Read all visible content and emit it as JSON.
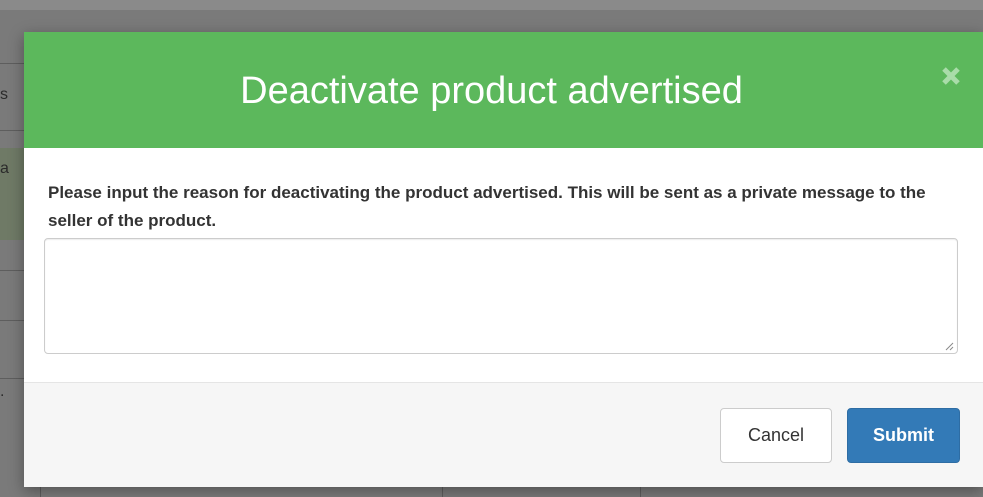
{
  "colors": {
    "header_bg": "#5cb85c",
    "primary_button": "#337ab7",
    "overlay": "#707070"
  },
  "background": {
    "fragments": [
      "s",
      "a",
      "."
    ]
  },
  "modal": {
    "title": "Deactivate product advertised",
    "close_icon": "close-icon",
    "body": {
      "reason_text": "Please input the reason for deactivating the product advertised. This will be sent as a private message to the seller of the product.",
      "reason_value": "",
      "reason_placeholder": ""
    },
    "footer": {
      "cancel_label": "Cancel",
      "submit_label": "Submit"
    }
  }
}
